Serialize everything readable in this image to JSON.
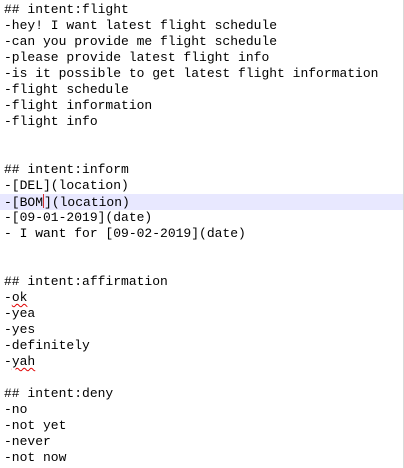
{
  "editor": {
    "lines": [
      "## intent:flight",
      "-hey! I want latest flight schedule",
      "-can you provide me flight schedule",
      "-please provide latest flight info",
      "-is it possible to get latest flight information",
      "-flight schedule",
      "-flight information",
      "-flight info",
      "",
      "",
      "## intent:inform",
      "-[DEL](location)",
      "-[BOM",
      "](location)",
      "-[09-01-2019](date)",
      "- I want for [09-02-2019](date)",
      "",
      "",
      "## intent:affirmation",
      "-",
      "ok",
      "-yea",
      "-yes",
      "-definitely",
      "-",
      "yah",
      "",
      "## intent:deny",
      "-no",
      "-not yet",
      "-never",
      "-not now"
    ]
  }
}
